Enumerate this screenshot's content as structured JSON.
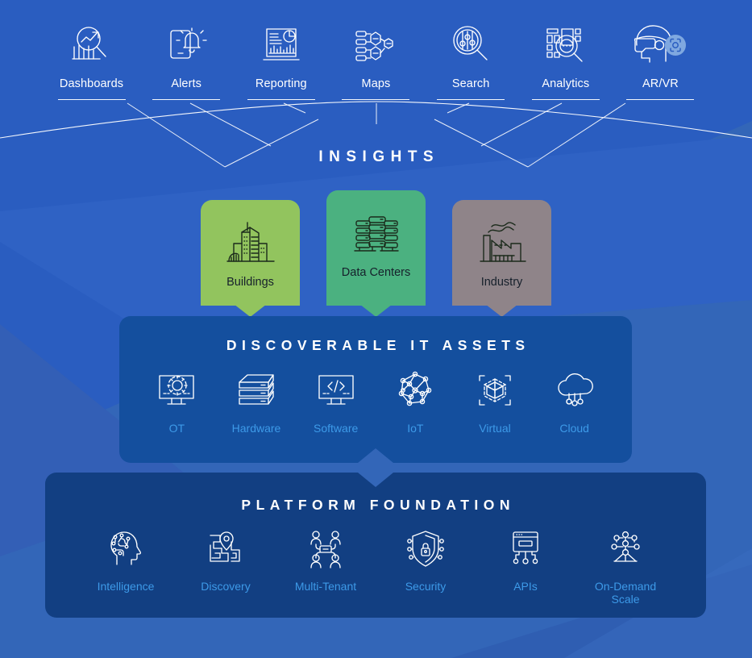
{
  "theme": {
    "bg_top": "#2a5dc0",
    "bg_bottom": "#3366b8",
    "panel_assets_bg": "#144f9e",
    "panel_foundation_bg": "#123f82",
    "tile_label_color": "#3d9ae8",
    "card_buildings_color": "#92c45e",
    "card_datacenters_color": "#4bb180",
    "card_industry_color": "#8f8489",
    "line_color": "#ffffff",
    "badge_color": "#7fa8e0"
  },
  "insights": {
    "title": "INSIGHTS",
    "items": [
      {
        "label": "Dashboards",
        "icon": "dashboard-search-chart-icon"
      },
      {
        "label": "Alerts",
        "icon": "phone-alert-bell-icon"
      },
      {
        "label": "Reporting",
        "icon": "report-chart-document-icon"
      },
      {
        "label": "Maps",
        "icon": "node-map-tree-icon"
      },
      {
        "label": "Search",
        "icon": "magnifier-sliders-icon"
      },
      {
        "label": "Analytics",
        "icon": "rack-magnifier-analytics-icon"
      },
      {
        "label": "AR/VR",
        "icon": "ar-vr-headset-icon",
        "badge": "scan-focus-badge-icon"
      }
    ]
  },
  "cards": [
    {
      "label": "Buildings",
      "icon": "city-buildings-icon",
      "color": "#92c45e"
    },
    {
      "label": "Data Centers",
      "icon": "server-stack-icon",
      "color": "#4bb180"
    },
    {
      "label": "Industry",
      "icon": "factory-smokestack-icon",
      "color": "#8f8489"
    }
  ],
  "assets_panel": {
    "title": "DISCOVERABLE IT ASSETS",
    "items": [
      {
        "label": "OT",
        "icon": "monitor-gear-icon"
      },
      {
        "label": "Hardware",
        "icon": "server-layers-icon"
      },
      {
        "label": "Software",
        "icon": "monitor-code-icon"
      },
      {
        "label": "IoT",
        "icon": "iot-mesh-network-icon"
      },
      {
        "label": "Virtual",
        "icon": "virtual-cube-brackets-icon"
      },
      {
        "label": "Cloud",
        "icon": "cloud-nodes-icon"
      }
    ]
  },
  "foundation_panel": {
    "title": "PLATFORM FOUNDATION",
    "items": [
      {
        "label": "Intelligence",
        "icon": "ai-head-circuit-icon"
      },
      {
        "label": "Discovery",
        "icon": "map-pin-maze-icon"
      },
      {
        "label": "Multi-Tenant",
        "icon": "multi-tenant-users-icon"
      },
      {
        "label": "Security",
        "icon": "shield-lock-icon"
      },
      {
        "label": "APIs",
        "icon": "api-window-nodes-icon"
      },
      {
        "label": "On-Demand Scale",
        "icon": "scale-tree-nodes-icon"
      }
    ]
  }
}
